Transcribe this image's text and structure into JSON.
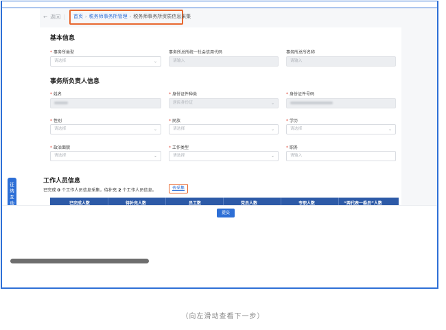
{
  "nav": {
    "back_label": "返回",
    "breadcrumbs": [
      "首页",
      "税务师事务所管理",
      "税务师事务所资质信息采集"
    ]
  },
  "sections": {
    "basic": {
      "title": "基本信息",
      "fields": [
        {
          "label": "事务所类型",
          "required": true,
          "placeholder": "请选择",
          "type": "select"
        },
        {
          "label": "事务所总所统一社会信用代码",
          "required": false,
          "placeholder": "请输入",
          "type": "input-disabled"
        },
        {
          "label": "事务所总所名称",
          "required": false,
          "placeholder": "请输入",
          "type": "input-disabled"
        }
      ]
    },
    "principal": {
      "title": "事务所负责人信息",
      "fields": [
        {
          "label": "姓名",
          "required": true,
          "placeholder": "",
          "type": "input-disabled-blurred"
        },
        {
          "label": "身份证件种类",
          "required": true,
          "placeholder": "居民身份证",
          "type": "select-disabled"
        },
        {
          "label": "身份证件号码",
          "required": true,
          "placeholder": "",
          "type": "input-disabled-blurred"
        },
        {
          "label": "性别",
          "required": true,
          "placeholder": "请选择",
          "type": "select"
        },
        {
          "label": "民族",
          "required": true,
          "placeholder": "请选择",
          "type": "select"
        },
        {
          "label": "学历",
          "required": true,
          "placeholder": "请选择",
          "type": "select"
        },
        {
          "label": "政治面貌",
          "required": true,
          "placeholder": "请选择",
          "type": "select"
        },
        {
          "label": "工作类型",
          "required": true,
          "placeholder": "请选择",
          "type": "select"
        },
        {
          "label": "职务",
          "required": true,
          "placeholder": "请输入",
          "type": "input"
        }
      ]
    },
    "staff": {
      "title": "工作人员信息",
      "status_text": {
        "pre": "已完成",
        "done": "0",
        "mid": "个工作人员信息采集，待补充",
        "todo": "2",
        "post": "个工作人员信息。"
      },
      "collect_link": "去采集",
      "table_headers": [
        "已完成人数",
        "待补充人数",
        "员工数",
        "党员人数",
        "专职人数",
        "“两代表一委员”人数"
      ]
    }
  },
  "footer": {
    "submit_label": "提交"
  },
  "floating_tab": {
    "label": "征纳互动"
  },
  "caption": "（向左滑动查看下一步）",
  "colors": {
    "accent": "#2d6fd6",
    "highlight": "#e8672e",
    "required": "#e04a3b",
    "table_header": "#2d5aa7"
  }
}
